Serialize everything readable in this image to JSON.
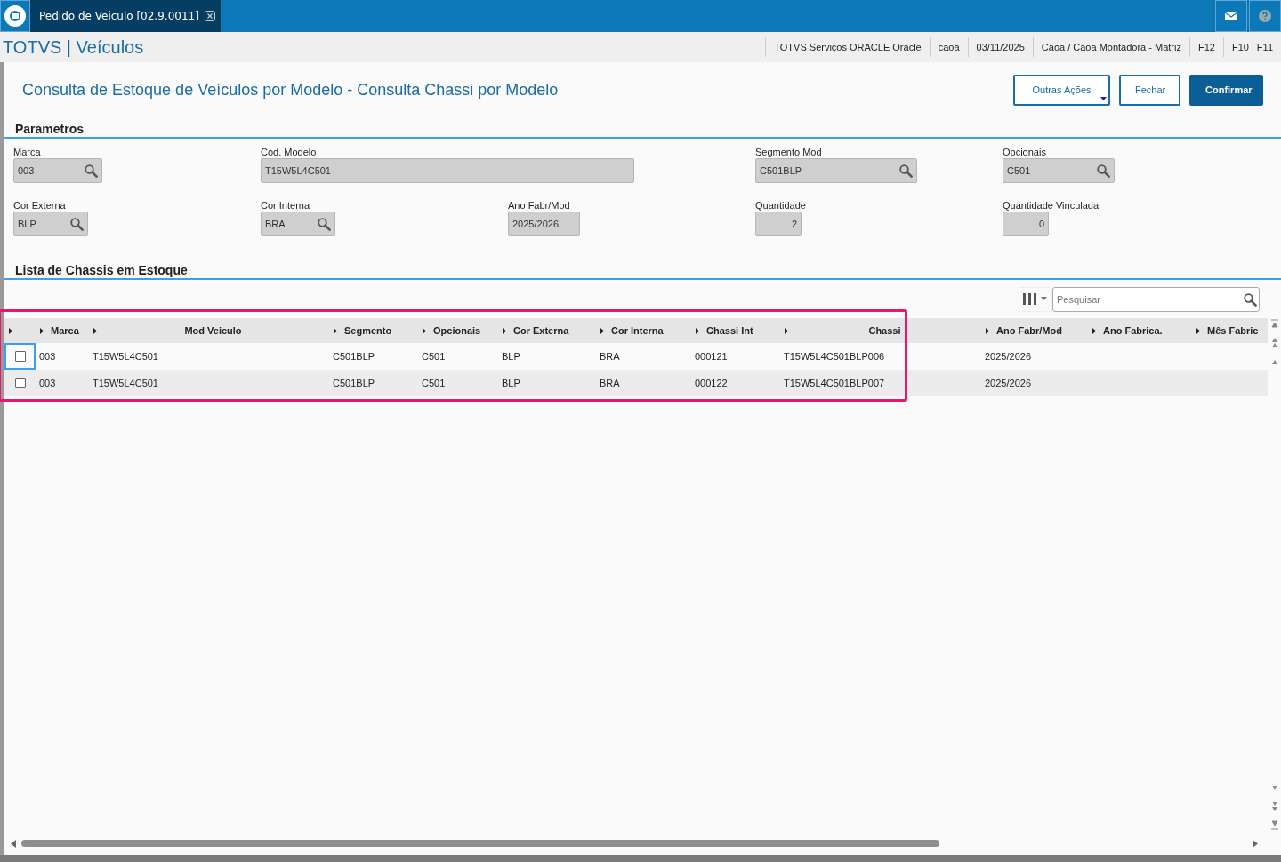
{
  "tab_bar": {
    "tabs": [
      {
        "label": "Pedido de Veiculo [02.9.0011]",
        "selected": true
      }
    ]
  },
  "header": {
    "brand": "TOTVS | Veículos",
    "info": [
      "TOTVS Serviços ORACLE Oracle",
      "caoa",
      "03/11/2025",
      "Caoa / Caoa Montadora - Matriz",
      "F12",
      "F10 | F11"
    ]
  },
  "page": {
    "title": "Consulta de Estoque de Veículos por Modelo - Consulta Chassi por Modelo",
    "buttons": [
      {
        "label": "Outras Ações",
        "kind": "menu"
      },
      {
        "label": "Fechar",
        "kind": "secondary"
      },
      {
        "label": "Confirmar",
        "kind": "primary"
      }
    ]
  },
  "parameters": {
    "title": "Parametros",
    "fields": [
      {
        "label": "Marca",
        "value": "003",
        "kind": "lookup"
      },
      {
        "label": "Cod. Modelo",
        "value": "T15W5L4C501",
        "kind": "text"
      },
      {
        "label": "Segmento Mod",
        "value": "C501BLP",
        "kind": "lookup"
      },
      {
        "label": "Opcionais",
        "value": "C501",
        "kind": "lookup"
      },
      {
        "label": "Cor Externa",
        "value": "BLP",
        "kind": "lookup"
      },
      {
        "label": "Cor Interna",
        "value": "BRA",
        "kind": "lookup"
      },
      {
        "label": "Ano Fabr/Mod",
        "value": "2025/2026",
        "kind": "text"
      },
      {
        "label": "Quantidade",
        "value": "2",
        "kind": "number"
      },
      {
        "label": "Quantidade Vinculada",
        "value": "0",
        "kind": "number"
      }
    ]
  },
  "chassis_list": {
    "title": "Lista de Chassis em Estoque",
    "search": {
      "placeholder": "Pesquisar"
    },
    "table": {
      "columns": [
        "Marca",
        "Mod Veiculo",
        "Segmento",
        "Opcionais",
        "Cor Externa",
        "Cor Interna",
        "Chassi Int",
        "Chassi",
        "Ano Fabr/Mod",
        "Ano Fabrica.",
        "Mês Fabric"
      ],
      "rows": [
        {
          "checked": false,
          "cells": [
            "003",
            "T15W5L4C501",
            "C501BLP",
            "C501",
            "BLP",
            "BRA",
            "000121",
            "T15W5L4C501BLP006",
            "2025/2026",
            "",
            ""
          ]
        },
        {
          "checked": false,
          "cells": [
            "003",
            "T15W5L4C501",
            "C501BLP",
            "C501",
            "BLP",
            "BRA",
            "000122",
            "T15W5L4C501BLP007",
            "2025/2026",
            "",
            ""
          ]
        }
      ]
    }
  }
}
